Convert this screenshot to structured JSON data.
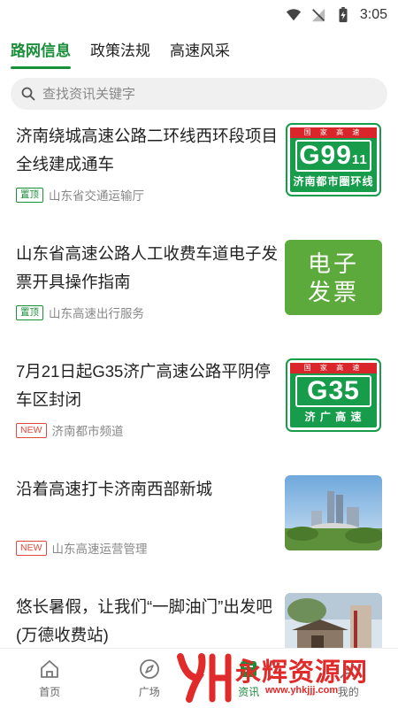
{
  "status_bar": {
    "time": "3:05"
  },
  "tabs": [
    {
      "label": "路网信息",
      "active": true
    },
    {
      "label": "政策法规",
      "active": false
    },
    {
      "label": "高速风采",
      "active": false
    }
  ],
  "search": {
    "placeholder": "查找资讯关键字"
  },
  "news": [
    {
      "title": "济南绕城高速公路二环线西环段项目全线建成通车",
      "tag": "置顶",
      "source": "山东省交通运输厅",
      "thumb": {
        "type": "sign",
        "top": "国 家 高 速",
        "code": "G99",
        "code_small": "11",
        "name": "济南都市圈环线"
      }
    },
    {
      "title": "山东省高速公路人工收费车道电子发票开具操作指南",
      "tag": "置顶",
      "source": "山东高速出行服务",
      "thumb": {
        "type": "invoice",
        "line1": "电子",
        "line2": "发票"
      }
    },
    {
      "title": "7月21日起G35济广高速公路平阴停车区封闭",
      "tag": "NEW",
      "source": "济南都市频道",
      "thumb": {
        "type": "sign",
        "top": "国 家 高 速",
        "code": "G35",
        "name": "济 广 高 速"
      }
    },
    {
      "title": "沿着高速打卡济南西部新城",
      "tag": "NEW",
      "source": "山东高速运营管理",
      "thumb": {
        "type": "photo",
        "icon": "city-skyline"
      }
    },
    {
      "title": "悠长暑假，让我们“一脚油门”出发吧(万德收费站)",
      "tag": "",
      "source": "",
      "thumb": {
        "type": "photo",
        "icon": "temple-stele"
      }
    }
  ],
  "bottom_nav": [
    {
      "label": "首页",
      "icon": "home-icon"
    },
    {
      "label": "广场",
      "icon": "compass-icon"
    },
    {
      "label": "资讯",
      "icon": "news-icon"
    },
    {
      "label": "我的",
      "icon": "user-icon"
    }
  ],
  "watermark": {
    "text": "永辉资源网",
    "url": "www.yhkjjj.com"
  },
  "colors": {
    "accent": "#1a8f3a",
    "new_tag": "#e04a3a",
    "sign_green": "#169c4a",
    "sign_red": "#d8262b"
  }
}
